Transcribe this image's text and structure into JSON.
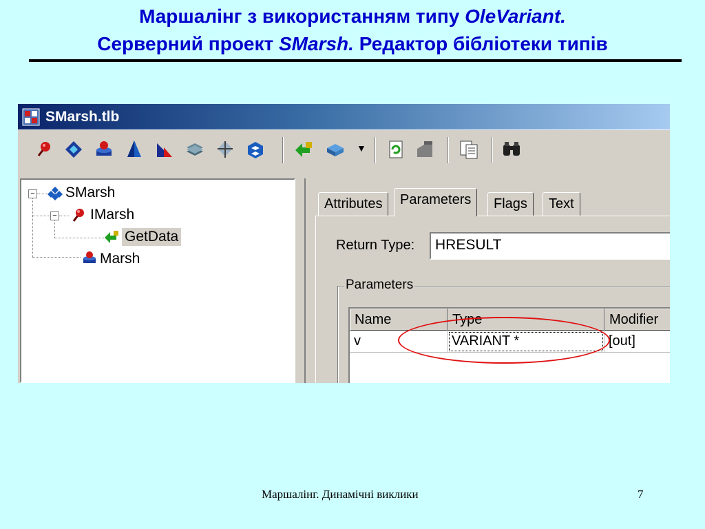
{
  "slide": {
    "title_line1_a": "Маршалінг з використанням типу ",
    "title_line1_b": "OleVariant.",
    "title_line2_a": "Серверний проект ",
    "title_line2_b": "SMarsh.",
    "title_line2_c": " Редактор бібліотеки типів",
    "footer": "Маршалінг. Динамічні виклики",
    "page_number": "7",
    "title_color": "#0000cc",
    "background_color": "#ccffff"
  },
  "window": {
    "title": "SMarsh.tlb",
    "app_icon": "typelib-icon"
  },
  "toolbar": {
    "group1": [
      "new-interface-icon",
      "new-dispinterface-icon",
      "new-coclass-icon",
      "new-enum-icon",
      "new-alias-icon",
      "new-record-icon",
      "new-union-icon",
      "new-module-icon"
    ],
    "group2": [
      "new-method-icon",
      "new-property-icon"
    ],
    "group3": [
      "refresh-icon",
      "register-icon"
    ],
    "group4": [
      "export-icon"
    ],
    "group5": [
      "find-icon"
    ]
  },
  "tree": {
    "root": {
      "label": "SMarsh",
      "icon": "library-icon"
    },
    "interface": {
      "label": "IMarsh",
      "icon": "interface-icon"
    },
    "method": {
      "label": "GetData",
      "icon": "method-icon"
    },
    "coclass": {
      "label": "Marsh",
      "icon": "coclass-icon"
    },
    "selected": "GetData"
  },
  "tabs": [
    {
      "label": "Attributes"
    },
    {
      "label": "Parameters",
      "active": true
    },
    {
      "label": "Flags"
    },
    {
      "label": "Text"
    }
  ],
  "parameters_page": {
    "return_type_label": "Return Type:",
    "return_type_value": "HRESULT",
    "group_label": "Parameters",
    "columns": [
      "Name",
      "Type",
      "Modifier"
    ],
    "rows": [
      {
        "name": "v",
        "type": "VARIANT *",
        "modifier": "[out]"
      }
    ],
    "highlight_color": "#e01010"
  }
}
